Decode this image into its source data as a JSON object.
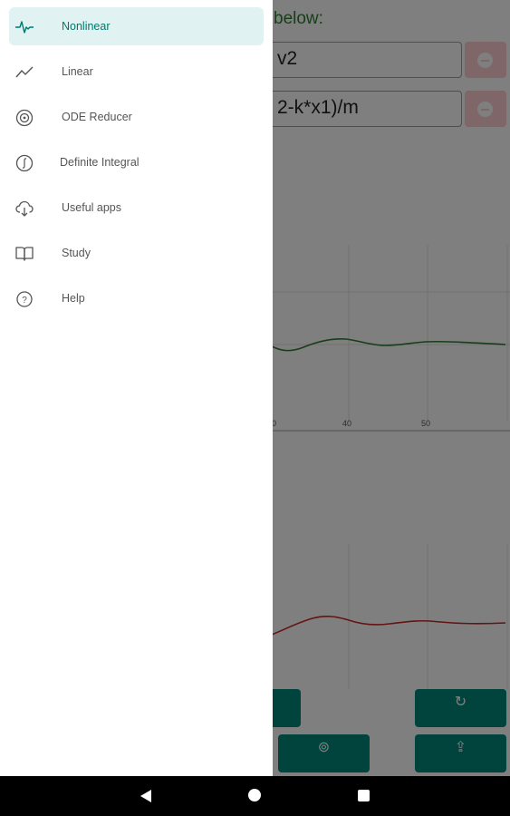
{
  "background": {
    "prompt_text": "below:",
    "equation_1": "v2",
    "equation_2": "2-k*x1)/m",
    "plot1": {
      "x_ticks": [
        "0",
        "40",
        "50"
      ],
      "line_color": "#2e7d32"
    },
    "plot2": {
      "line_color": "#c62828"
    },
    "buttons": {
      "refresh_icon": "refresh-icon",
      "stop_icon": "stop-icon",
      "share_icon": "share-icon",
      "refresh_label": "",
      "stop_label": "",
      "share_label": ""
    }
  },
  "drawer": {
    "items": [
      {
        "label": "Nonlinear",
        "icon": "pulse-icon",
        "active": true
      },
      {
        "label": "Linear",
        "icon": "trend-icon",
        "active": false
      },
      {
        "label": "ODE Reducer",
        "icon": "target-icon",
        "active": false
      },
      {
        "label": "Definite Integral",
        "icon": "integral-icon",
        "active": false
      },
      {
        "label": "Useful apps",
        "icon": "cloud-download-icon",
        "active": false
      },
      {
        "label": "Study",
        "icon": "book-icon",
        "active": false
      },
      {
        "label": "Help",
        "icon": "help-icon",
        "active": false
      }
    ]
  },
  "colors": {
    "accent": "#00897b",
    "active_bg": "#e0f2f1",
    "active_text": "#00796b",
    "delete_button": "#ffcdd2"
  }
}
